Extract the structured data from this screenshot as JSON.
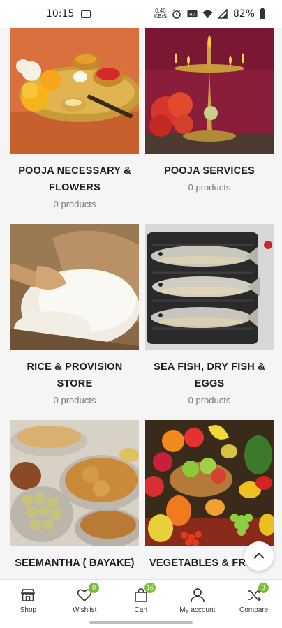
{
  "status_bar": {
    "time": "10:15",
    "data_speed": "0.40\nKB/S",
    "battery": "82%"
  },
  "categories": [
    {
      "title": "POOJA NECESSARY & FLOWERS",
      "count": "0 products",
      "icon": "pooja-items-image"
    },
    {
      "title": "POOJA SERVICES",
      "count": "0 products",
      "icon": "brass-lamp-image"
    },
    {
      "title": "RICE & PROVISION STORE",
      "count": "0 products",
      "icon": "rice-sack-image"
    },
    {
      "title": "SEA FISH, DRY FISH & EGGS",
      "count": "0 products",
      "icon": "fish-tray-image"
    },
    {
      "title": "SEEMANTHA ( BAYAKE)",
      "count": "",
      "icon": "sweets-snacks-image"
    },
    {
      "title": "VEGETABLES & FRUITS",
      "count": "",
      "icon": "fruits-basket-image"
    }
  ],
  "bottom_nav": [
    {
      "label": "Shop",
      "icon": "shop-icon",
      "badge": ""
    },
    {
      "label": "Wishlist",
      "icon": "heart-icon",
      "badge": "0"
    },
    {
      "label": "Cart",
      "icon": "bag-icon",
      "badge": "16"
    },
    {
      "label": "My account",
      "icon": "user-icon",
      "badge": ""
    },
    {
      "label": "Compare",
      "icon": "shuffle-icon",
      "badge": "0"
    }
  ],
  "colors": {
    "badge": "#7cbd3b",
    "background": "#f5f5f5"
  }
}
